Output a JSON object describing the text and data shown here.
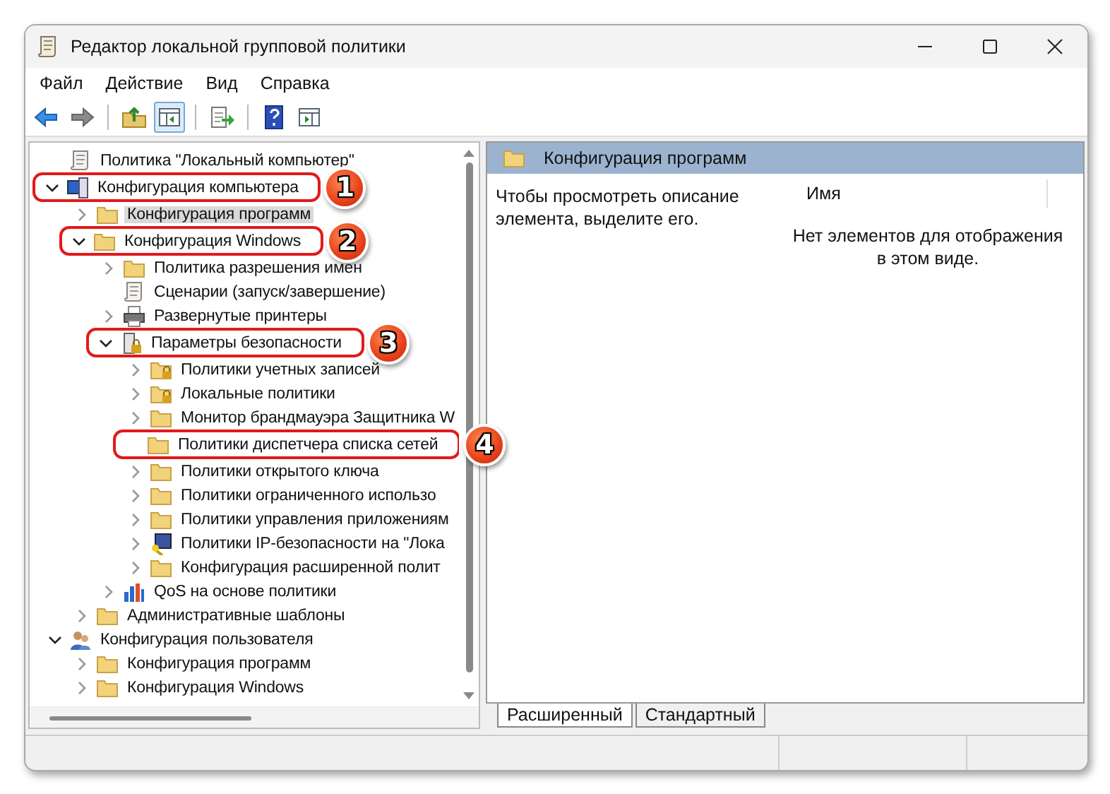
{
  "window": {
    "title": "Редактор локальной групповой политики"
  },
  "menu": [
    "Файл",
    "Действие",
    "Вид",
    "Справка"
  ],
  "toolbar": [
    {
      "kind": "back",
      "pressed": false
    },
    {
      "kind": "forward",
      "pressed": false
    },
    {
      "kind": "sep"
    },
    {
      "kind": "up",
      "pressed": false
    },
    {
      "kind": "tree",
      "pressed": true
    },
    {
      "kind": "sep"
    },
    {
      "kind": "export",
      "pressed": false
    },
    {
      "kind": "sep"
    },
    {
      "kind": "help",
      "pressed": false
    },
    {
      "kind": "pane",
      "pressed": false
    }
  ],
  "tree": {
    "label": "Политика \"Локальный компьютер\"",
    "kind": "scroll",
    "children": [
      {
        "label": "Конфигурация компьютера",
        "kind": "computer",
        "expanded": true,
        "callout": "1",
        "children": [
          {
            "label": "Конфигурация программ",
            "kind": "folder",
            "expanded": false,
            "selected": true
          },
          {
            "label": "Конфигурация Windows",
            "kind": "folder",
            "expanded": true,
            "callout": "2",
            "children": [
              {
                "label": "Политика разрешения имен",
                "kind": "folder",
                "expanded": false
              },
              {
                "label": "Сценарии (запуск/завершение)",
                "kind": "scroll"
              },
              {
                "label": "Развернутые принтеры",
                "kind": "printer",
                "expanded": false
              },
              {
                "label": "Параметры безопасности",
                "kind": "security",
                "expanded": true,
                "callout": "3",
                "children": [
                  {
                    "label": "Политики учетных записей",
                    "kind": "lockfolder",
                    "expanded": false
                  },
                  {
                    "label": "Локальные политики",
                    "kind": "lockfolder",
                    "expanded": false
                  },
                  {
                    "label": "Монитор брандмауэра Защитника W",
                    "kind": "folder",
                    "expanded": false
                  },
                  {
                    "label": "Политики диспетчера списка сетей",
                    "kind": "folder",
                    "callout": "4"
                  },
                  {
                    "label": "Политики открытого ключа",
                    "kind": "folder",
                    "expanded": false
                  },
                  {
                    "label": "Политики ограниченного использо",
                    "kind": "folder",
                    "expanded": false
                  },
                  {
                    "label": "Политики управления приложениям",
                    "kind": "folder",
                    "expanded": false
                  },
                  {
                    "label": "Политики IP-безопасности на \"Лока",
                    "kind": "ip",
                    "expanded": false
                  },
                  {
                    "label": "Конфигурация расширенной полит",
                    "kind": "folder",
                    "expanded": false
                  }
                ]
              },
              {
                "label": "QoS на основе политики",
                "kind": "chart",
                "expanded": false
              }
            ]
          },
          {
            "label": "Административные шаблоны",
            "kind": "folder",
            "expanded": false
          }
        ]
      },
      {
        "label": "Конфигурация пользователя",
        "kind": "user",
        "expanded": true,
        "children": [
          {
            "label": "Конфигурация программ",
            "kind": "folder",
            "expanded": false
          },
          {
            "label": "Конфигурация Windows",
            "kind": "folder",
            "expanded": false
          }
        ]
      }
    ]
  },
  "details": {
    "header": "Конфигурация программ",
    "description": "Чтобы просмотреть описание элемента, выделите его.",
    "columns": [
      "Имя"
    ],
    "empty_message": "Нет элементов для отображения в этом виде."
  },
  "view_tabs": [
    {
      "label": "Расширенный",
      "selected": true
    },
    {
      "label": "Стандартный",
      "selected": false
    }
  ]
}
